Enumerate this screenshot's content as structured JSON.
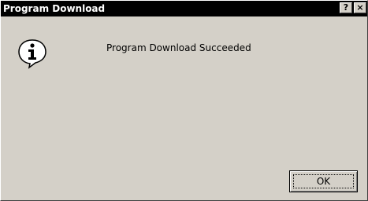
{
  "window": {
    "title": "Program Download"
  },
  "titlebar": {
    "help_label": "?",
    "close_label": "×"
  },
  "dialog": {
    "icon": "information-icon",
    "message": "Program Download Succeeded",
    "ok_label": "OK"
  },
  "colors": {
    "titlebar_bg": "#000000",
    "title_text": "#ffffff",
    "dialog_bg": "#d4d0c8",
    "icon_fill": "#ffffff"
  }
}
